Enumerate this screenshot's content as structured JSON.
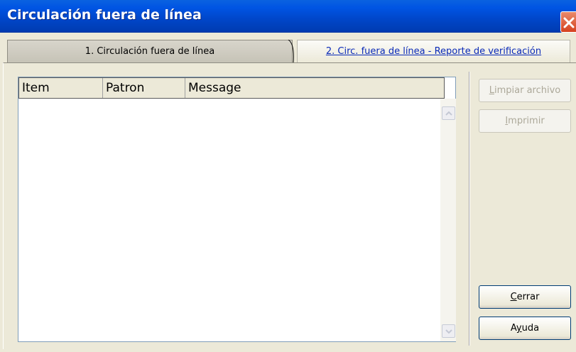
{
  "window": {
    "title": "Circulación fuera de línea"
  },
  "tabs": [
    {
      "label": "1. Circulación fuera de línea",
      "active": true
    },
    {
      "label": "2. Circ. fuera de línea - Reporte de verificación",
      "active": false
    }
  ],
  "list": {
    "columns": [
      "Item",
      "Patron",
      "Message"
    ],
    "rows": []
  },
  "buttons": {
    "limpiar": {
      "first": "L",
      "rest": "impiar archivo",
      "enabled": false
    },
    "imprimir": {
      "first": "I",
      "rest": "mprimir",
      "enabled": false
    },
    "cerrar": {
      "first": "C",
      "rest": "errar",
      "enabled": true
    },
    "ayuda": {
      "pre": "A",
      "mid": "y",
      "post": "uda",
      "enabled": true
    }
  },
  "icons": {
    "close": "close-icon",
    "scroll_up": "chevron-up-icon",
    "scroll_down": "chevron-down-icon"
  },
  "colors": {
    "titlebar": "#0054e3",
    "close_button": "#d6411f",
    "window_bg": "#ece9d8",
    "active_tab_link": "#0a2ab8",
    "disabled_text": "#aca899"
  }
}
